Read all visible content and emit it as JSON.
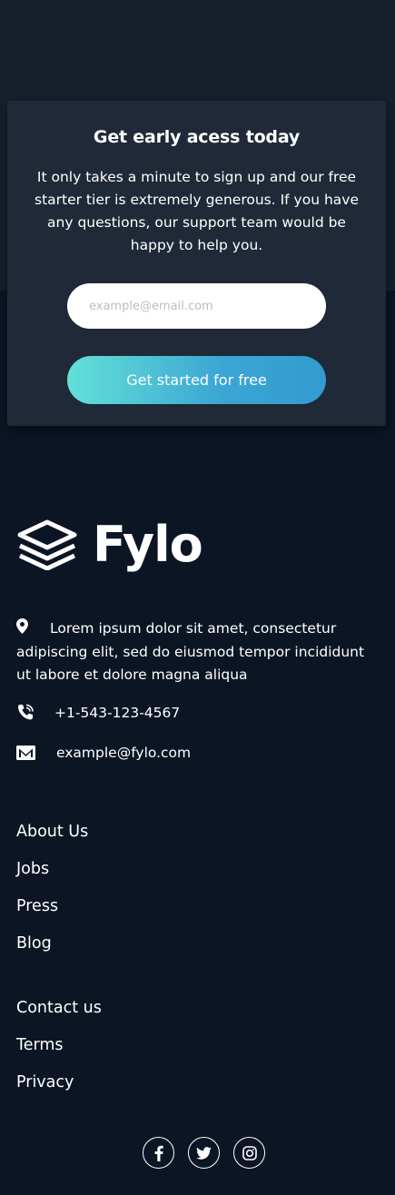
{
  "signup": {
    "title": "Get early acess today",
    "description": "It only takes a minute to sign up and our free starter tier is extremely generous. If you have any questions, our support team would be happy to help you.",
    "email_placeholder": "example@email.com",
    "cta_label": "Get started for free"
  },
  "footer": {
    "logo_text": "Fylo",
    "address": "Lorem ipsum dolor sit amet, consectetur adipiscing elit, sed do eiusmod tempor incididunt ut labore et dolore magna aliqua",
    "phone": "+1-543-123-4567",
    "email": "example@fylo.com",
    "links_primary": [
      "About Us",
      "Jobs",
      "Press",
      "Blog"
    ],
    "links_secondary": [
      "Contact us",
      "Terms",
      "Privacy"
    ],
    "socials": [
      "facebook-icon",
      "twitter-icon",
      "instagram-icon"
    ]
  },
  "colors": {
    "page_bg": "#0c1524",
    "top_band": "#181f2d",
    "card_bg": "#1f2937",
    "cta_gradient_start": "#63e0d8",
    "cta_gradient_end": "#339bd0"
  }
}
